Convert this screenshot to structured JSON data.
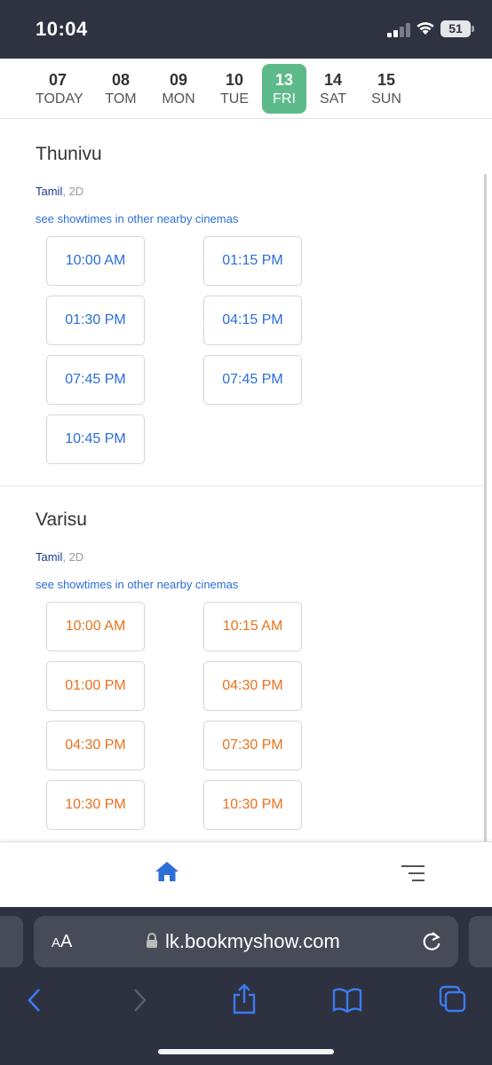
{
  "status_bar": {
    "time": "10:04",
    "battery": "51"
  },
  "dates": [
    {
      "num": "07",
      "day": "TODAY",
      "active": false
    },
    {
      "num": "08",
      "day": "TOM",
      "active": false
    },
    {
      "num": "09",
      "day": "MON",
      "active": false
    },
    {
      "num": "10",
      "day": "TUE",
      "active": false
    },
    {
      "num": "13",
      "day": "FRI",
      "active": true
    },
    {
      "num": "14",
      "day": "SAT",
      "active": false
    },
    {
      "num": "15",
      "day": "SUN",
      "active": false
    }
  ],
  "movies": [
    {
      "title": "Thunivu",
      "language": "Tamil",
      "format": ", 2D",
      "nearby_link": "see showtimes in other nearby cinemas",
      "color": "#2b6fd6",
      "showtimes": [
        "10:00 AM",
        "01:15 PM",
        "01:30 PM",
        "04:15 PM",
        "07:45 PM",
        "07:45 PM",
        "10:45 PM"
      ]
    },
    {
      "title": "Varisu",
      "language": "Tamil",
      "format": ", 2D",
      "nearby_link": "see showtimes in other nearby cinemas",
      "color": "#e8731f",
      "showtimes": [
        "10:00 AM",
        "10:15 AM",
        "01:00 PM",
        "04:30 PM",
        "04:30 PM",
        "07:30 PM",
        "10:30 PM",
        "10:30 PM"
      ]
    }
  ],
  "bottom_nav": {
    "home_icon": "home-icon",
    "menu_icon": "menu-icon",
    "accent": "#2b6fd6"
  },
  "safari": {
    "text_size": "AA",
    "url": "lk.bookmyshow.com",
    "toolbar_icons": [
      "back-icon",
      "forward-icon",
      "share-icon",
      "bookmarks-icon",
      "tabs-icon"
    ]
  }
}
